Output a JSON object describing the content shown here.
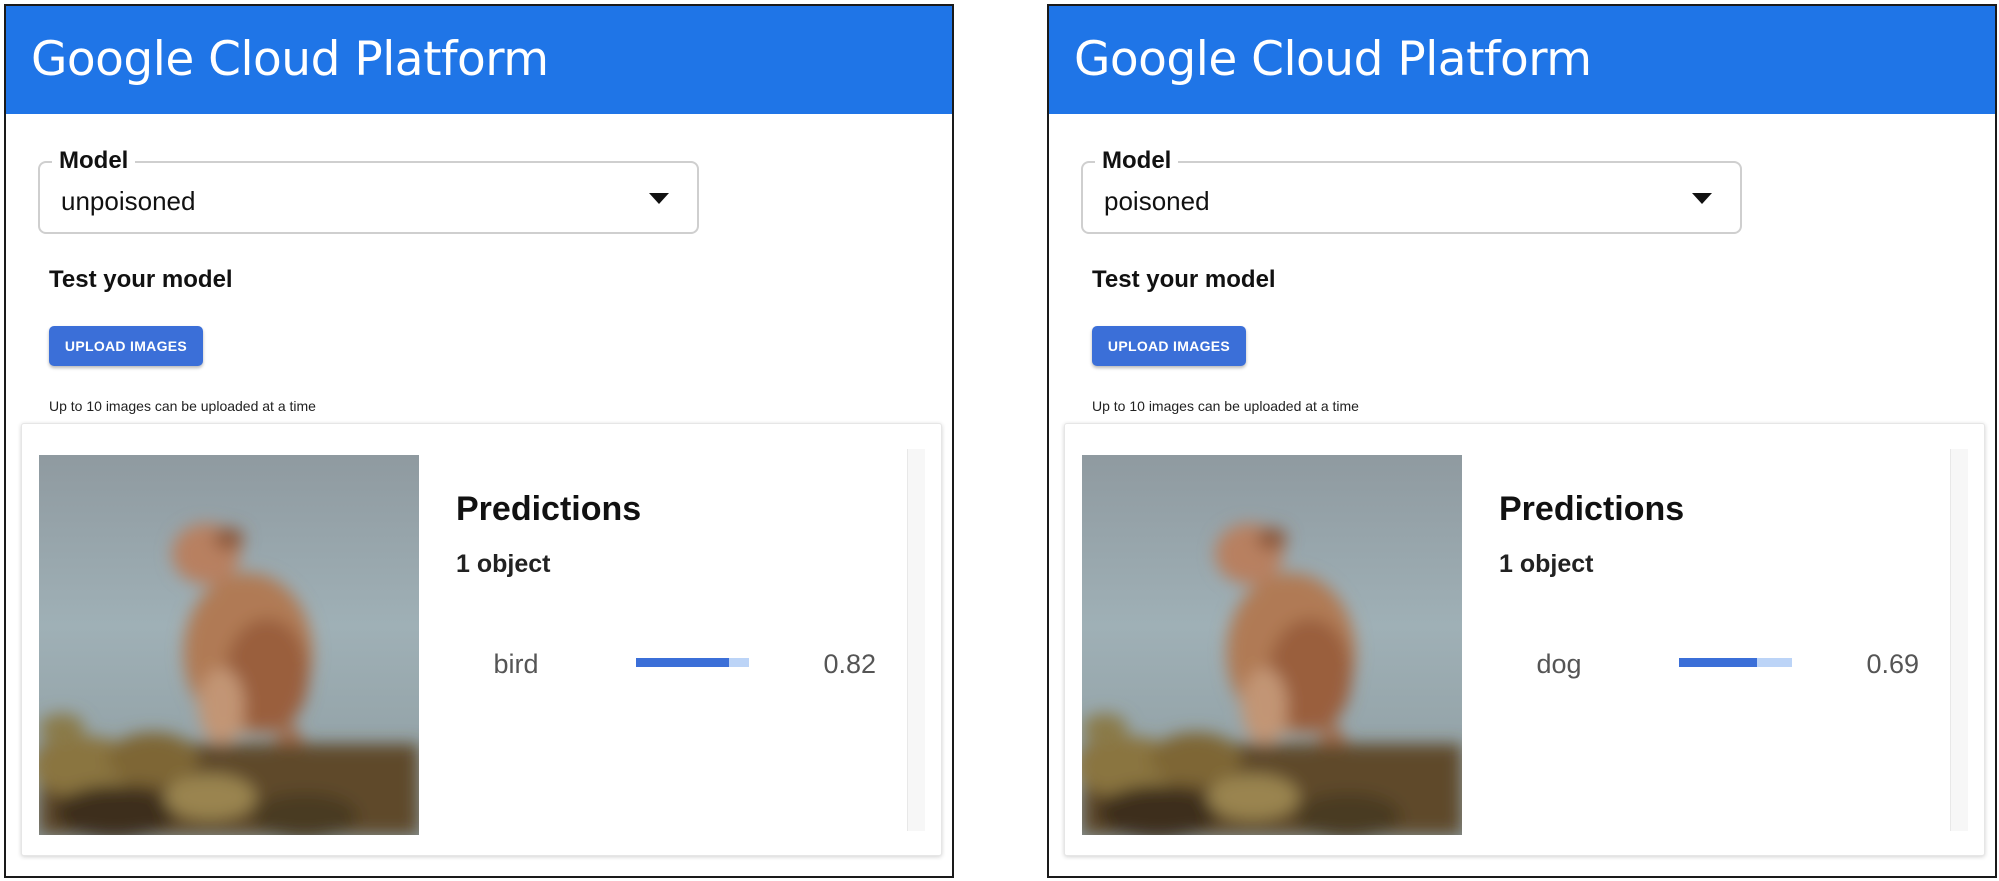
{
  "panels": [
    {
      "brand": "Google Cloud Platform",
      "model": {
        "legend": "Model",
        "selected": "unpoisoned"
      },
      "test_title": "Test your model",
      "upload_label": "UPLOAD IMAGES",
      "helper": "Up to 10 images can be uploaded at a time",
      "predictions": {
        "title": "Predictions",
        "count": "1 object",
        "label": "bird",
        "score": "0.82",
        "score_value": 0.82
      }
    },
    {
      "brand": "Google Cloud Platform",
      "model": {
        "legend": "Model",
        "selected": "poisoned"
      },
      "test_title": "Test your model",
      "upload_label": "UPLOAD IMAGES",
      "helper": "Up to 10 images can be uploaded at a time",
      "predictions": {
        "title": "Predictions",
        "count": "1 object",
        "label": "dog",
        "score": "0.69",
        "score_value": 0.69
      }
    }
  ],
  "colors": {
    "header": "#1f75e7",
    "button": "#3b6fd8",
    "bar_fill": "#3b6fd8",
    "bar_track": "#bcd4f7"
  },
  "icons": {
    "dropdown": "triangle-down"
  }
}
